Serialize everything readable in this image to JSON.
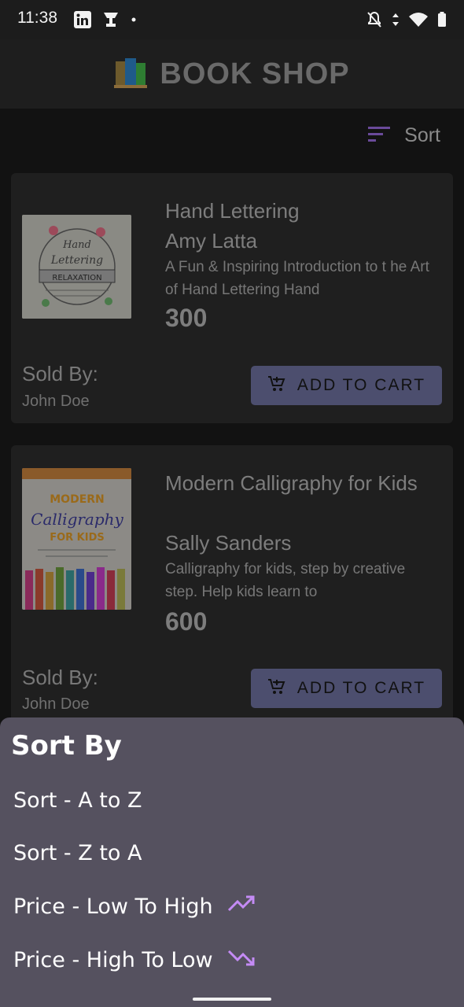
{
  "status_bar": {
    "time": "11:38",
    "left_icons": [
      "linkedin-icon",
      "trophy-icon",
      "dot-icon"
    ],
    "right_icons": [
      "notifications-off-icon",
      "data-arrows-icon",
      "wifi-icon",
      "battery-icon"
    ]
  },
  "app_bar": {
    "title": "BOOK SHOP",
    "logo": "books-logo-icon"
  },
  "sort_button": {
    "label": "Sort",
    "icon": "sort-icon",
    "accent": "#6a4a9a"
  },
  "books": [
    {
      "title": "Hand Lettering",
      "author": "Amy Latta",
      "description": "A Fun & Inspiring Introduction to t he Art of Hand Lettering Hand",
      "price": "300",
      "sold_by_label": "Sold By:",
      "seller": "John Doe",
      "cart_label": "ADD TO CART",
      "cover_text": "Hand Lettering for RELAXATION"
    },
    {
      "title": "Modern Calligraphy for Kids",
      "author": "Sally Sanders",
      "description": "Calligraphy for kids, step by creative step. Help kids learn to",
      "price": "600",
      "sold_by_label": "Sold By:",
      "seller": "John Doe",
      "cart_label": "ADD TO CART",
      "cover_text": "MODERN Calligraphy FOR KIDS"
    }
  ],
  "sort_sheet": {
    "title": "Sort By",
    "options": [
      {
        "label": "Sort - A to Z",
        "icon": ""
      },
      {
        "label": "Sort - Z to A",
        "icon": ""
      },
      {
        "label": "Price - Low To High",
        "icon": "trending-up-icon"
      },
      {
        "label": "Price - High To Low",
        "icon": "trending-down-icon"
      }
    ],
    "icon_color": "#c48bf5"
  },
  "colors": {
    "background": "#121212",
    "card": "#1f1f1f",
    "button": "#4c4e6e",
    "sheet": "#55515f"
  }
}
